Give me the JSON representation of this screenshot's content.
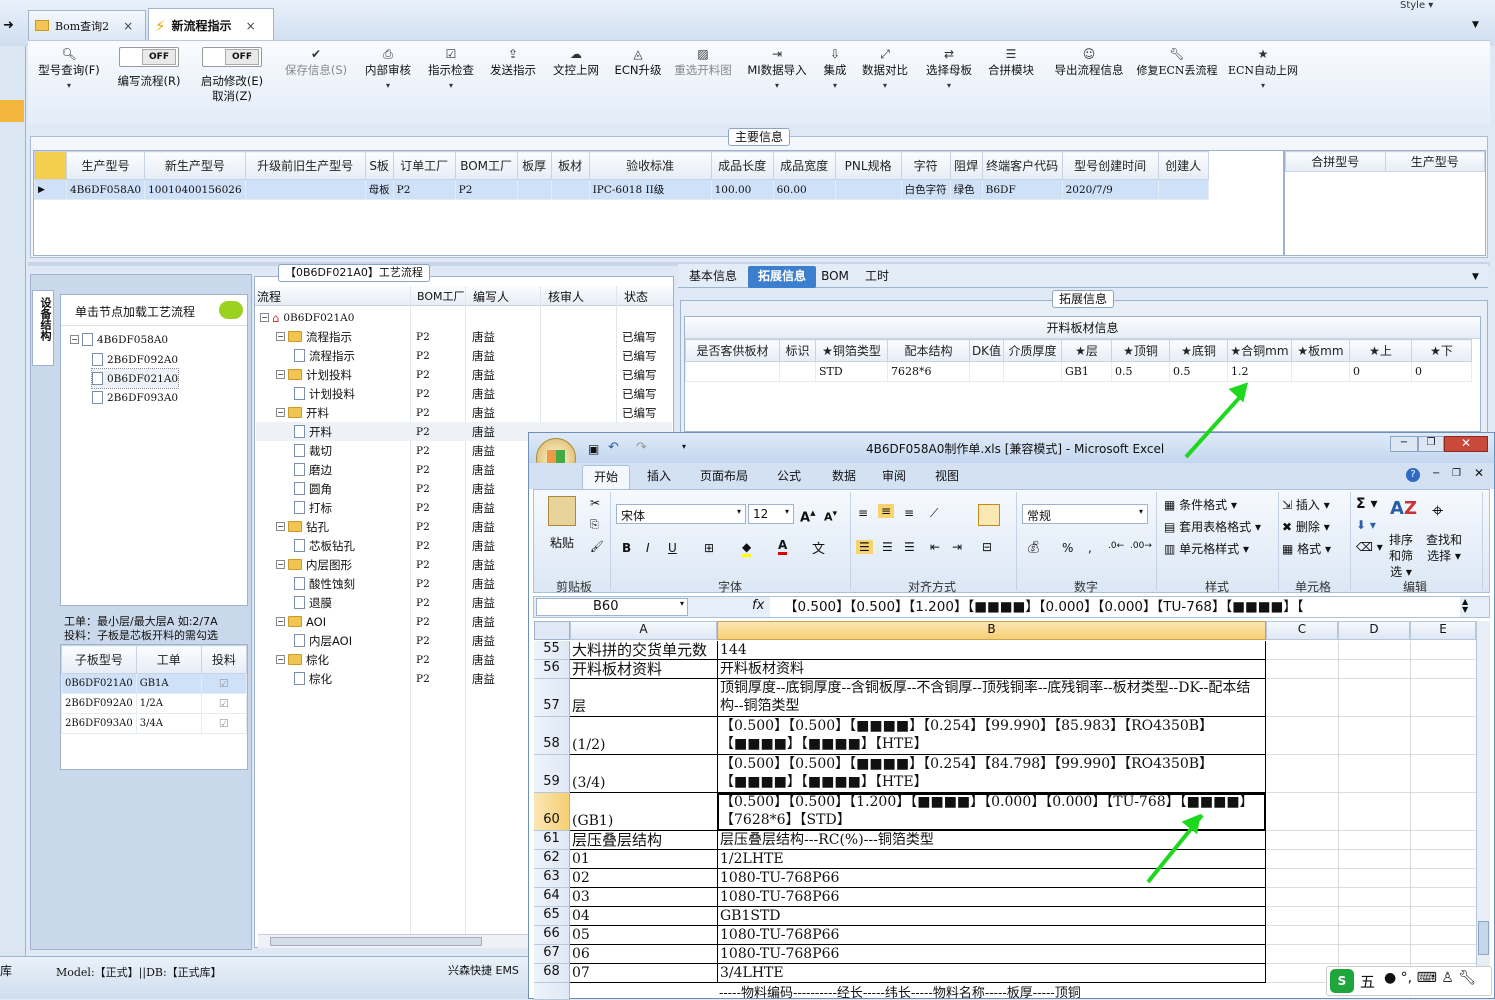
{
  "tabs": [
    {
      "label": "Bom查询2"
    },
    {
      "label": "新流程指示"
    }
  ],
  "style_label": "Style",
  "ribbon": {
    "buttons": [
      "型号查询(F)",
      "编写流程(R)",
      "启动修改(E)",
      "取消(Z)",
      "保存信息(S)",
      "内部审核",
      "指示检查",
      "发送指示",
      "文控上网",
      "ECN升级",
      "重选开料图",
      "MI数据导入",
      "集成",
      "数据对比",
      "选择母板",
      "合拼模块",
      "导出流程信息",
      "修复ECN丢流程",
      "ECN自动上网"
    ],
    "toggle_off": "OFF"
  },
  "main_info": {
    "title": "主要信息",
    "headers": [
      "生产型号",
      "新生产型号",
      "升级前旧生产型号",
      "S板",
      "订单工厂",
      "BOM工厂",
      "板厚",
      "板材",
      "验收标准",
      "成品长度",
      "成品宽度",
      "PNL规格",
      "字符",
      "阻焊",
      "终端客户代码",
      "型号创建时间",
      "创建人"
    ],
    "row": [
      "4B6DF058A0",
      "10010400156026",
      "",
      "母板",
      "P2",
      "P2",
      "",
      "",
      "IPC-6018 II级",
      "100.00",
      "60.00",
      "",
      "白色字符",
      "绿色",
      "B6DF",
      "2020/7/9",
      ""
    ],
    "right_headers": [
      "合拼型号",
      "生产型号"
    ]
  },
  "left_panel": {
    "vtab": "设备结构",
    "hint": "单击节点加载工艺流程",
    "tree": [
      "4B6DF058A0",
      "2B6DF092A0",
      "0B6DF021A0",
      "2B6DF093A0"
    ],
    "note1": "工单：最小层/最大层A 如:2/7A",
    "note2": "投料：子板是芯板开料的需勾选",
    "sub_headers": [
      "子板型号",
      "工单",
      "投料"
    ],
    "sub_rows": [
      [
        "0B6DF021A0",
        "GB1A"
      ],
      [
        "2B6DF092A0",
        "1/2A"
      ],
      [
        "2B6DF093A0",
        "3/4A"
      ]
    ]
  },
  "flow": {
    "title": "【0B6DF021A0】工艺流程",
    "headers": [
      "流程",
      "BOM工厂",
      "编写人",
      "核审人",
      "状态"
    ],
    "root": "0B6DF021A0",
    "rows": [
      {
        "label": "流程指示",
        "type": "folder",
        "level": 1,
        "bom": "P2",
        "writer": "唐益",
        "status": "已编写"
      },
      {
        "label": "流程指示",
        "type": "doc",
        "level": 2,
        "bom": "P2",
        "writer": "唐益",
        "status": "已编写"
      },
      {
        "label": "计划投料",
        "type": "folder",
        "level": 1,
        "bom": "P2",
        "writer": "唐益",
        "status": "已编写"
      },
      {
        "label": "计划投料",
        "type": "doc",
        "level": 2,
        "bom": "P2",
        "writer": "唐益",
        "status": "已编写"
      },
      {
        "label": "开料",
        "type": "folder",
        "level": 1,
        "bom": "P2",
        "writer": "唐益",
        "status": "已编写"
      },
      {
        "label": "开料",
        "type": "doc",
        "level": 2,
        "bom": "P2",
        "writer": "唐益",
        "status": ""
      },
      {
        "label": "裁切",
        "type": "doc",
        "level": 2,
        "bom": "P2",
        "writer": "唐益",
        "status": ""
      },
      {
        "label": "磨边",
        "type": "doc",
        "level": 2,
        "bom": "P2",
        "writer": "唐益",
        "status": ""
      },
      {
        "label": "圆角",
        "type": "doc",
        "level": 2,
        "bom": "P2",
        "writer": "唐益",
        "status": ""
      },
      {
        "label": "打标",
        "type": "doc",
        "level": 2,
        "bom": "P2",
        "writer": "唐益",
        "status": ""
      },
      {
        "label": "钻孔",
        "type": "folder",
        "level": 1,
        "bom": "P2",
        "writer": "唐益",
        "status": ""
      },
      {
        "label": "芯板钻孔",
        "type": "doc",
        "level": 2,
        "bom": "P2",
        "writer": "唐益",
        "status": ""
      },
      {
        "label": "内层图形",
        "type": "folder",
        "level": 1,
        "bom": "P2",
        "writer": "唐益",
        "status": ""
      },
      {
        "label": "酸性蚀刻",
        "type": "doc",
        "level": 2,
        "bom": "P2",
        "writer": "唐益",
        "status": ""
      },
      {
        "label": "退膜",
        "type": "doc",
        "level": 2,
        "bom": "P2",
        "writer": "唐益",
        "status": ""
      },
      {
        "label": "AOI",
        "type": "folder",
        "level": 1,
        "bom": "P2",
        "writer": "唐益",
        "status": ""
      },
      {
        "label": "内层AOI",
        "type": "doc",
        "level": 2,
        "bom": "P2",
        "writer": "唐益",
        "status": ""
      },
      {
        "label": "棕化",
        "type": "folder",
        "level": 1,
        "bom": "P2",
        "writer": "唐益",
        "status": ""
      },
      {
        "label": "棕化",
        "type": "doc",
        "level": 2,
        "bom": "P2",
        "writer": "唐益",
        "status": ""
      }
    ]
  },
  "ext": {
    "tabs": [
      "基本信息",
      "拓展信息",
      "BOM",
      "工时"
    ],
    "legend": "拓展信息",
    "table_title": "开料板材信息",
    "headers": [
      "是否客供板材",
      "标识",
      "★铜箔类型",
      "配本结构",
      "DK值",
      "介质厚度",
      "★层",
      "★顶铜",
      "★底铜",
      "★合铜mm",
      "★板mm",
      "★上",
      "★下"
    ],
    "row": [
      "",
      "",
      "STD",
      "7628*6",
      "",
      "",
      "GB1",
      "0.5",
      "0.5",
      "1.2",
      "",
      "0",
      "0"
    ]
  },
  "status_bar": {
    "left": "库",
    "model": "Model:【正式】||DB:【正式库】",
    "right": "兴森快捷 EMS"
  },
  "excel": {
    "title": "4B6DF058A0制作单.xls [兼容模式] - Microsoft Excel",
    "tabs": [
      "开始",
      "插入",
      "页面布局",
      "公式",
      "数据",
      "审阅",
      "视图"
    ],
    "font": "宋体",
    "size": "12",
    "numfmt": "常规",
    "groups": [
      "剪贴板",
      "字体",
      "对齐方式",
      "数字",
      "样式",
      "单元格",
      "编辑"
    ],
    "btn_paste": "粘贴",
    "style_btns": [
      "条件格式",
      "套用表格格式",
      "单元格样式"
    ],
    "cell_btns": [
      "插入",
      "删除",
      "格式"
    ],
    "edit_btns": [
      "排序和筛选",
      "查找和选择"
    ],
    "namebox": "B60",
    "formula": "【0.500】【0.500】【1.200】【■■■■】【0.000】【0.000】【TU-768】【■■■■】【",
    "cols": [
      "A",
      "B",
      "C",
      "D",
      "E"
    ],
    "rows": [
      {
        "n": "55",
        "a": "大料拼的交货单元数",
        "b": "144"
      },
      {
        "n": "56",
        "a": "开料板材资料",
        "b": "开料板材资料"
      },
      {
        "n": "57",
        "a": "层",
        "b": "顶铜厚度--底铜厚度--含铜板厚--不含铜厚--顶残铜率--底残铜率--板材类型--DK--配本结构--铜箔类型"
      },
      {
        "n": "58",
        "a": "(1/2)",
        "b": "【0.500】【0.500】【■■■■】【0.254】【99.990】【85.983】【RO4350B】【■■■■】【■■■■】【HTE】"
      },
      {
        "n": "59",
        "a": "(3/4)",
        "b": "【0.500】【0.500】【■■■■】【0.254】【84.798】【99.990】【RO4350B】【■■■■】【■■■■】【HTE】"
      },
      {
        "n": "60",
        "a": "(GB1)",
        "b": "【0.500】【0.500】【1.200】【■■■■】【0.000】【0.000】【TU-768】【■■■■】【7628*6】【STD】"
      },
      {
        "n": "61",
        "a": "层压叠层结构",
        "b": "层压叠层结构---RC(%)---铜箔类型"
      },
      {
        "n": "62",
        "a": "01",
        "b": "1/2LHTE"
      },
      {
        "n": "63",
        "a": "02",
        "b": "1080-TU-768P66"
      },
      {
        "n": "64",
        "a": "03",
        "b": "1080-TU-768P66"
      },
      {
        "n": "65",
        "a": "04",
        "b": "GB1STD"
      },
      {
        "n": "66",
        "a": "05",
        "b": "1080-TU-768P66"
      },
      {
        "n": "67",
        "a": "06",
        "b": "1080-TU-768P66"
      },
      {
        "n": "68",
        "a": "07",
        "b": "3/4LHTE"
      }
    ],
    "partial_row": "-----物料编码----------经长-----纬长-----物料名称-----板厚-----顶铜"
  },
  "ime": "五"
}
